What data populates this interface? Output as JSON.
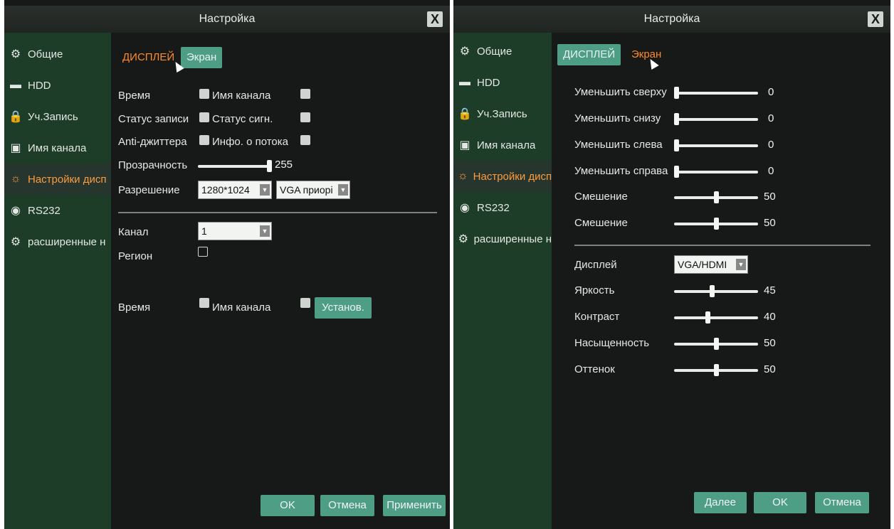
{
  "colors": {
    "sidebar": "#1d3d28",
    "accent": "#ff9b3d",
    "button": "#4e9e86",
    "panel": "#171918"
  },
  "left": {
    "title": "Настройка",
    "close": "X",
    "sidebar": [
      {
        "icon": "⚙",
        "label": "Общие"
      },
      {
        "icon": "▬",
        "label": "HDD"
      },
      {
        "icon": "🔒",
        "label": "Уч.Запись"
      },
      {
        "icon": "▣",
        "label": "Имя канала"
      },
      {
        "icon": "☼",
        "label": "Настройки дисп"
      },
      {
        "icon": "◉",
        "label": "RS232"
      },
      {
        "icon": "⚙",
        "label": "расширенные н"
      }
    ],
    "tabs": [
      "ДИСПЛЕЙ",
      "Экран"
    ],
    "osd": {
      "time": "Время",
      "channel_name": "Имя канала",
      "record_status": "Статус записи",
      "signal_status": "Статус сигн.",
      "anti_jitter": "Anti-джиттера",
      "stream_info": "Инфо. о потока"
    },
    "transparency": {
      "label": "Прозрачность",
      "value": "255",
      "level": 1.0
    },
    "resolution": {
      "label": "Разрешение",
      "value": "1280*1024",
      "priority": "VGA приорі"
    },
    "channel": {
      "label": "Канал",
      "value": "1"
    },
    "region": {
      "label": "Регион"
    },
    "bottom_row": {
      "time": "Время",
      "channel_name": "Имя канала",
      "set_button": "Установ."
    },
    "buttons": {
      "ok": "OK",
      "cancel": "Отмена",
      "apply": "Применить"
    }
  },
  "right": {
    "title": "Настройка",
    "close": "X",
    "sidebar": [
      {
        "icon": "⚙",
        "label": "Общие"
      },
      {
        "icon": "▬",
        "label": "HDD"
      },
      {
        "icon": "🔒",
        "label": "Уч.Запись"
      },
      {
        "icon": "▣",
        "label": "Имя канала"
      },
      {
        "icon": "☼",
        "label": "Настройки дисп"
      },
      {
        "icon": "◉",
        "label": "RS232"
      },
      {
        "icon": "⚙",
        "label": "расширенные н"
      }
    ],
    "tabs": [
      "ДИСПЛЕЙ",
      "Экран"
    ],
    "sliders": [
      {
        "label": "Уменьшить сверху",
        "value": "0",
        "level": 0
      },
      {
        "label": "Уменьшить снизу",
        "value": "0",
        "level": 0
      },
      {
        "label": "Уменьшить слева",
        "value": "0",
        "level": 0
      },
      {
        "label": "Уменьшить справа",
        "value": "0",
        "level": 0
      },
      {
        "label": "Смешение",
        "value": "50",
        "level": 0.5
      },
      {
        "label": "Смешение",
        "value": "50",
        "level": 0.5
      }
    ],
    "display": {
      "label": "Дисплей",
      "value": "VGA/HDMI"
    },
    "image_sliders": [
      {
        "label": "Яркость",
        "value": "45",
        "level": 0.45
      },
      {
        "label": "Контраст",
        "value": "40",
        "level": 0.4
      },
      {
        "label": "Насыщенность",
        "value": "50",
        "level": 0.5
      },
      {
        "label": "Оттенок",
        "value": "50",
        "level": 0.5
      }
    ],
    "buttons": {
      "next": "Далее",
      "ok": "OK",
      "cancel": "Отмена"
    }
  }
}
